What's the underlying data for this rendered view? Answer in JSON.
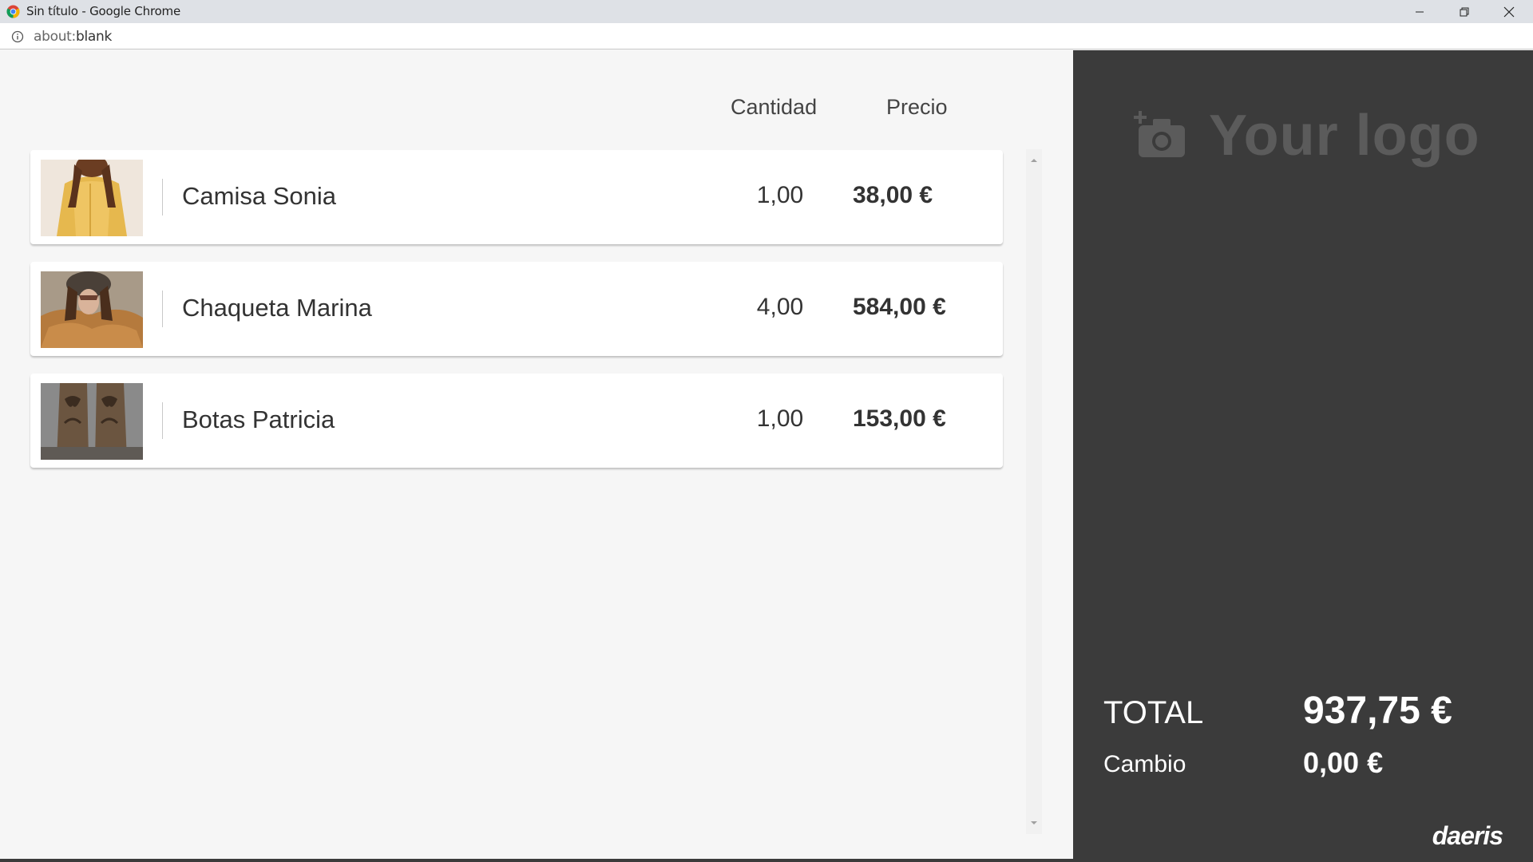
{
  "window": {
    "title": "Sin título - Google Chrome",
    "address_prefix": "about:",
    "address_rest": "blank"
  },
  "table": {
    "header_quantity": "Cantidad",
    "header_price": "Precio",
    "items": [
      {
        "name": "Camisa Sonia",
        "quantity": "1,00",
        "price": "38,00 €",
        "image": "yellow-shirt-photo"
      },
      {
        "name": "Chaqueta Marina",
        "quantity": "4,00",
        "price": "584,00 €",
        "image": "fur-jacket-photo"
      },
      {
        "name": "Botas Patricia",
        "quantity": "1,00",
        "price": "153,00 €",
        "image": "cowboy-boots-photo"
      }
    ]
  },
  "summary": {
    "logo_text": "Your logo",
    "total_label": "TOTAL",
    "total_value": "937,75 €",
    "change_label": "Cambio",
    "change_value": "0,00 €",
    "brand": "daeris"
  },
  "colors": {
    "panel_bg": "#3b3b3b",
    "content_bg": "#f6f6f6",
    "titlebar_bg": "#dee1e6"
  },
  "icons": {
    "browser": "chrome-icon",
    "info": "info-icon",
    "logo": "camera-plus-icon"
  }
}
